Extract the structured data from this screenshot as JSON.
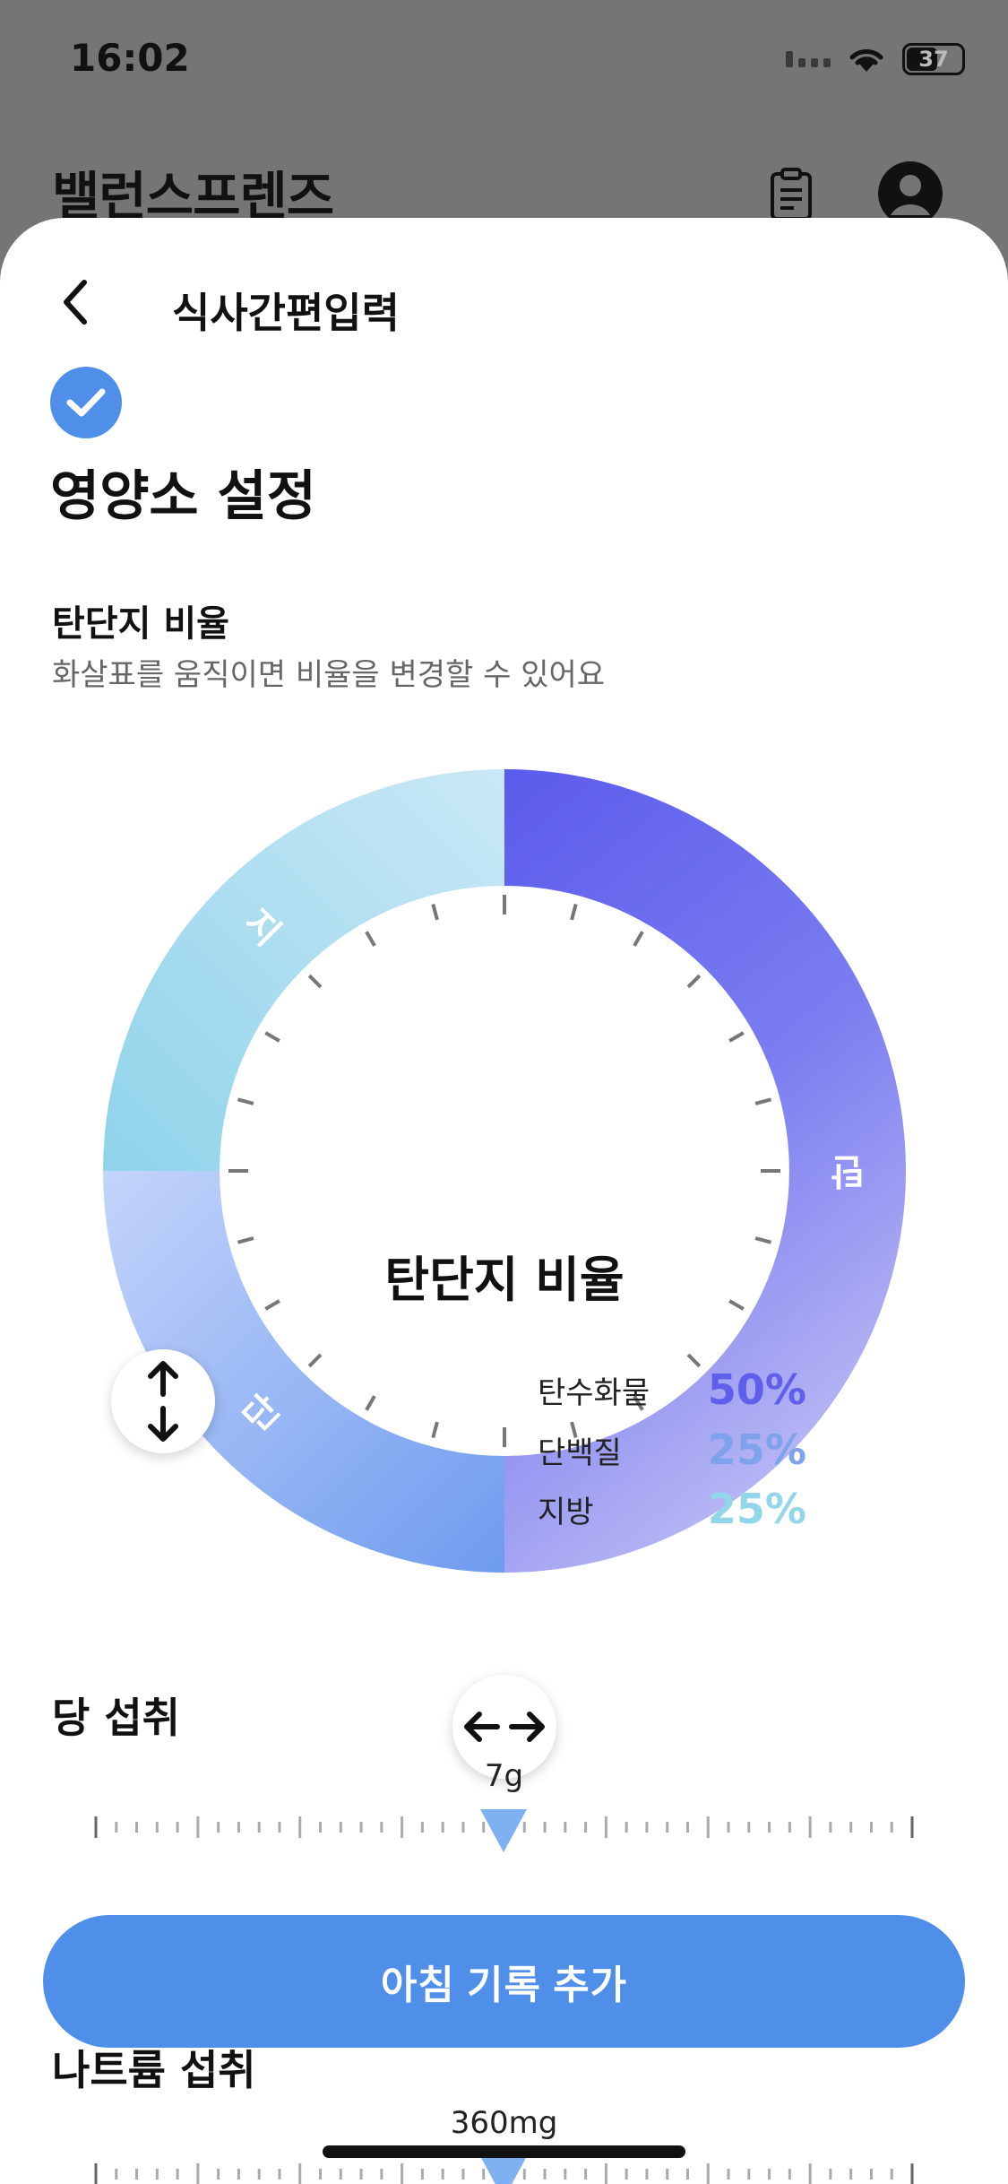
{
  "status_bar": {
    "time": "16:02",
    "battery": "37",
    "icons": [
      "signal-icon",
      "wifi-icon",
      "battery-icon"
    ]
  },
  "background_app": {
    "title": "밸런스프렌즈",
    "icons": [
      "clipboard-icon",
      "profile-icon"
    ]
  },
  "sheet": {
    "title": "식사간편입력",
    "back_icon": "chevron-left-icon",
    "section_icon": "check-circle-icon",
    "section_title": "영양소 설정"
  },
  "macro_ratio": {
    "label": "탄단지 비율",
    "description": "화살표를 움직이면 비율을 변경할 수 있어요",
    "center_title": "탄단지 비율",
    "segment_labels": {
      "carb": "탄",
      "protein": "단",
      "fat": "지"
    },
    "items": [
      {
        "name": "탄수화물",
        "percent": "50%",
        "value": 50,
        "color": "#5f5fec"
      },
      {
        "name": "단백질",
        "percent": "25%",
        "value": 25,
        "color": "#7ea3ec"
      },
      {
        "name": "지방",
        "percent": "25%",
        "value": 25,
        "color": "#93d6ea"
      }
    ],
    "handle_icons": [
      "vertical-arrows-icon",
      "horizontal-arrows-icon"
    ]
  },
  "sugar": {
    "title": "당 섭취",
    "value_label": "7g"
  },
  "sodium": {
    "title": "나트륨 섭취",
    "value_label": "360mg"
  },
  "cta": {
    "label": "아침 기록 추가"
  }
}
